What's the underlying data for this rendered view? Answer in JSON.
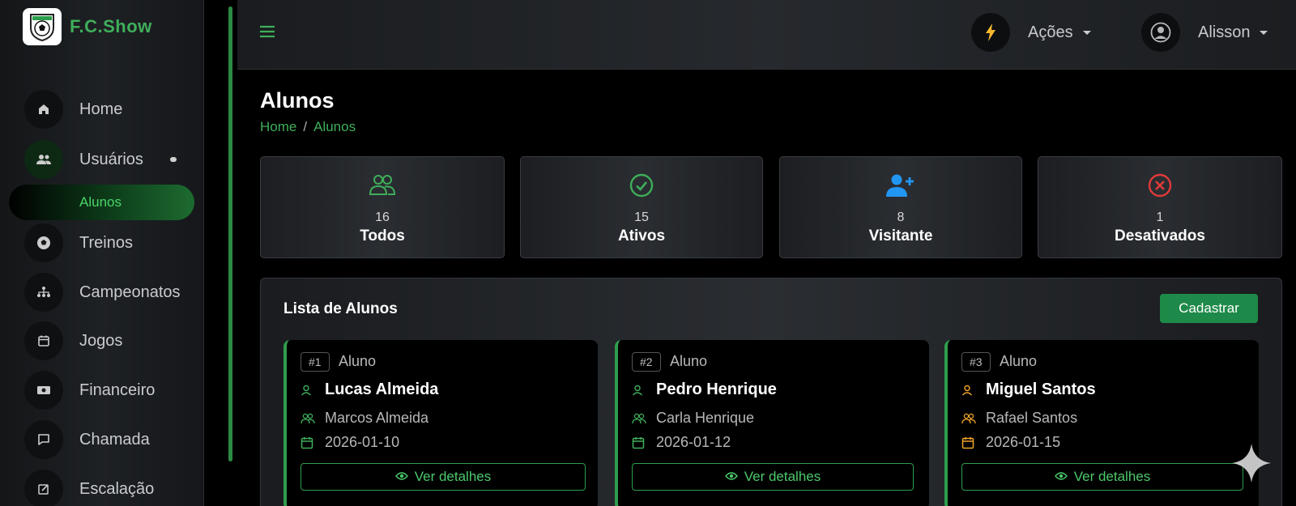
{
  "brand": {
    "name": "F.C.Show"
  },
  "colors": {
    "accent": "#3fae5a",
    "primary_button": "#1e8a49",
    "visitor": "#2196f3",
    "danger": "#e03b3b",
    "warning": "#f0a42a"
  },
  "sidebar": {
    "items": [
      {
        "label": "Home",
        "icon": "home-icon"
      },
      {
        "label": "Usuários",
        "icon": "users-icon"
      },
      {
        "label": "Treinos",
        "icon": "soccer-ball-icon"
      },
      {
        "label": "Campeonatos",
        "icon": "tournament-icon"
      },
      {
        "label": "Jogos",
        "icon": "calendar-icon"
      },
      {
        "label": "Financeiro",
        "icon": "money-icon"
      },
      {
        "label": "Chamada",
        "icon": "chat-icon"
      },
      {
        "label": "Escalação",
        "icon": "edit-icon"
      }
    ],
    "sub_active": "Alunos"
  },
  "topbar": {
    "actions_label": "Ações",
    "user_name": "Alisson"
  },
  "page": {
    "title": "Alunos",
    "breadcrumb": [
      "Home",
      "Alunos"
    ],
    "breadcrumb_sep": "/"
  },
  "stats": [
    {
      "value": "16",
      "label": "Todos",
      "icon": "group-icon"
    },
    {
      "value": "15",
      "label": "Ativos",
      "icon": "check-circle-icon"
    },
    {
      "value": "8",
      "label": "Visitante",
      "icon": "user-plus-icon"
    },
    {
      "value": "1",
      "label": "Desativados",
      "icon": "x-circle-icon"
    }
  ],
  "list": {
    "title": "Lista de Alunos",
    "add_button": "Cadastrar",
    "details_label": "Ver detalhes",
    "cards": [
      {
        "badge": "#1",
        "role": "Aluno",
        "name": "Lucas Almeida",
        "guardian": "Marcos Almeida",
        "date": "2026-01-10"
      },
      {
        "badge": "#2",
        "role": "Aluno",
        "name": "Pedro Henrique",
        "guardian": "Carla Henrique",
        "date": "2026-01-12"
      },
      {
        "badge": "#3",
        "role": "Aluno",
        "name": "Miguel Santos",
        "guardian": "Rafael Santos",
        "date": "2026-01-15"
      }
    ]
  }
}
